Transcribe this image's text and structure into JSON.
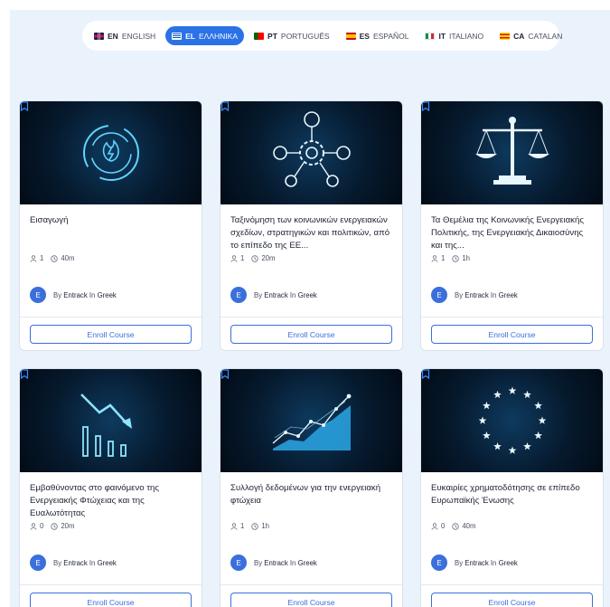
{
  "languages": [
    {
      "code": "EN",
      "name": "ENGLISH",
      "flag": "flag-gb",
      "active": false
    },
    {
      "code": "EL",
      "name": "ΕΛΛΗΝΙΚΑ",
      "flag": "flag-gr",
      "active": true
    },
    {
      "code": "PT",
      "name": "PORTUGUÊS",
      "flag": "flag-pt",
      "active": false
    },
    {
      "code": "ES",
      "name": "ESPAÑOL",
      "flag": "flag-es",
      "active": false
    },
    {
      "code": "IT",
      "name": "ITALIANO",
      "flag": "flag-it",
      "active": false
    },
    {
      "code": "CA",
      "name": "CATALAN",
      "flag": "flag-ca",
      "active": false
    }
  ],
  "courses": [
    {
      "title": "Εισαγωγή",
      "lessons": "1",
      "duration": "40m",
      "author_initial": "E",
      "by": "By",
      "author": "Entrack",
      "in": "In",
      "category": "Greek",
      "enroll": "Enroll Course",
      "image_icon": "energy-cycle-icon"
    },
    {
      "title": "Ταξινόμηση των κοινωνικών ενεργειακών σχεδίων, στρατηγικών και πολιτικών, από το επίπεδο της ΕΕ...",
      "lessons": "1",
      "duration": "20m",
      "author_initial": "E",
      "by": "By",
      "author": "Entrack",
      "in": "In",
      "category": "Greek",
      "enroll": "Enroll Course",
      "image_icon": "network-gear-icon"
    },
    {
      "title": "Τα Θεμέλια της Κοινωνικής Ενεργειακής Πολιτικής, της Ενεργειακής Δικαιοσύνης και της...",
      "lessons": "1",
      "duration": "1h",
      "author_initial": "E",
      "by": "By",
      "author": "Entrack",
      "in": "In",
      "category": "Greek",
      "enroll": "Enroll Course",
      "image_icon": "justice-scale-icon"
    },
    {
      "title": "Εμβαθύνοντας στο φαινόμενο της Ενεργειακής Φτώχειας και της Ευαλωτότητας",
      "lessons": "0",
      "duration": "20m",
      "author_initial": "E",
      "by": "By",
      "author": "Entrack",
      "in": "In",
      "category": "Greek",
      "enroll": "Enroll Course",
      "image_icon": "declining-chart-icon"
    },
    {
      "title": "Συλλογή δεδομένων για την ενεργειακή φτώχεια",
      "lessons": "1",
      "duration": "1h",
      "author_initial": "E",
      "by": "By",
      "author": "Entrack",
      "in": "In",
      "category": "Greek",
      "enroll": "Enroll Course",
      "image_icon": "rising-chart-icon"
    },
    {
      "title": "Ευκαιρίες χρηματοδότησης σε επίπεδο Ευρωπαϊκής Ένωσης",
      "lessons": "0",
      "duration": "40m",
      "author_initial": "E",
      "by": "By",
      "author": "Entrack",
      "in": "In",
      "category": "Greek",
      "enroll": "Enroll Course",
      "image_icon": "eu-stars-icon"
    }
  ],
  "colors": {
    "accent": "#2b72e6",
    "glow": "#5fd4ff",
    "page_bg": "#eaf3fc"
  }
}
